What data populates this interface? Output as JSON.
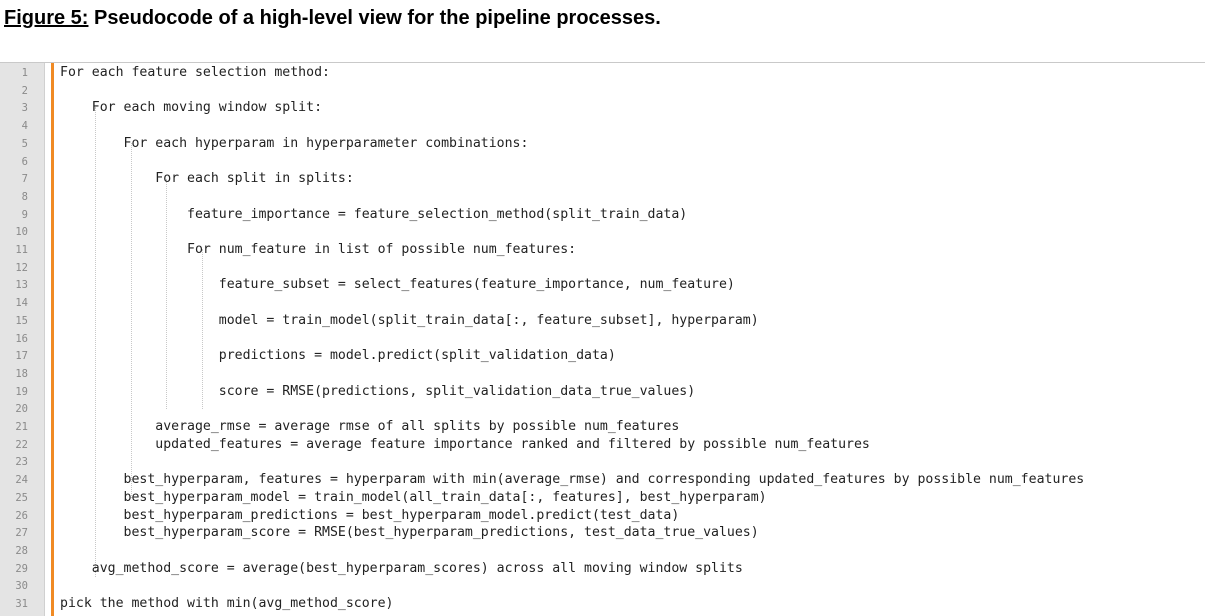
{
  "title": {
    "label": "Figure 5:",
    "text": " Pseudocode of a high-level view for the pipeline processes."
  },
  "line_numbers": [
    "1",
    "2",
    "3",
    "4",
    "5",
    "6",
    "7",
    "8",
    "9",
    "10",
    "11",
    "12",
    "13",
    "14",
    "15",
    "16",
    "17",
    "18",
    "19",
    "20",
    "21",
    "22",
    "23",
    "24",
    "25",
    "26",
    "27",
    "28",
    "29",
    "30",
    "31"
  ],
  "code_lines": [
    "For each feature selection method:",
    "",
    "    For each moving window split:",
    "",
    "        For each hyperparam in hyperparameter combinations:",
    "",
    "            For each split in splits:",
    "",
    "                feature_importance = feature_selection_method(split_train_data)",
    "",
    "                For num_feature in list of possible num_features:",
    "",
    "                    feature_subset = select_features(feature_importance, num_feature)",
    "",
    "                    model = train_model(split_train_data[:, feature_subset], hyperparam)",
    "",
    "                    predictions = model.predict(split_validation_data)",
    "",
    "                    score = RMSE(predictions, split_validation_data_true_values)",
    "",
    "            average_rmse = average rmse of all splits by possible num_features",
    "            updated_features = average feature importance ranked and filtered by possible num_features",
    "",
    "        best_hyperparam, features = hyperparam with min(average_rmse) and corresponding updated_features by possible num_features",
    "        best_hyperparam_model = train_model(all_train_data[:, features], best_hyperparam)",
    "        best_hyperparam_predictions = best_hyperparam_model.predict(test_data)",
    "        best_hyperparam_score = RMSE(best_hyperparam_predictions, test_data_true_values)",
    "",
    "    avg_method_score = average(best_hyperparam_scores) across all moving window splits",
    "",
    "pick the method with min(avg_method_score)"
  ]
}
